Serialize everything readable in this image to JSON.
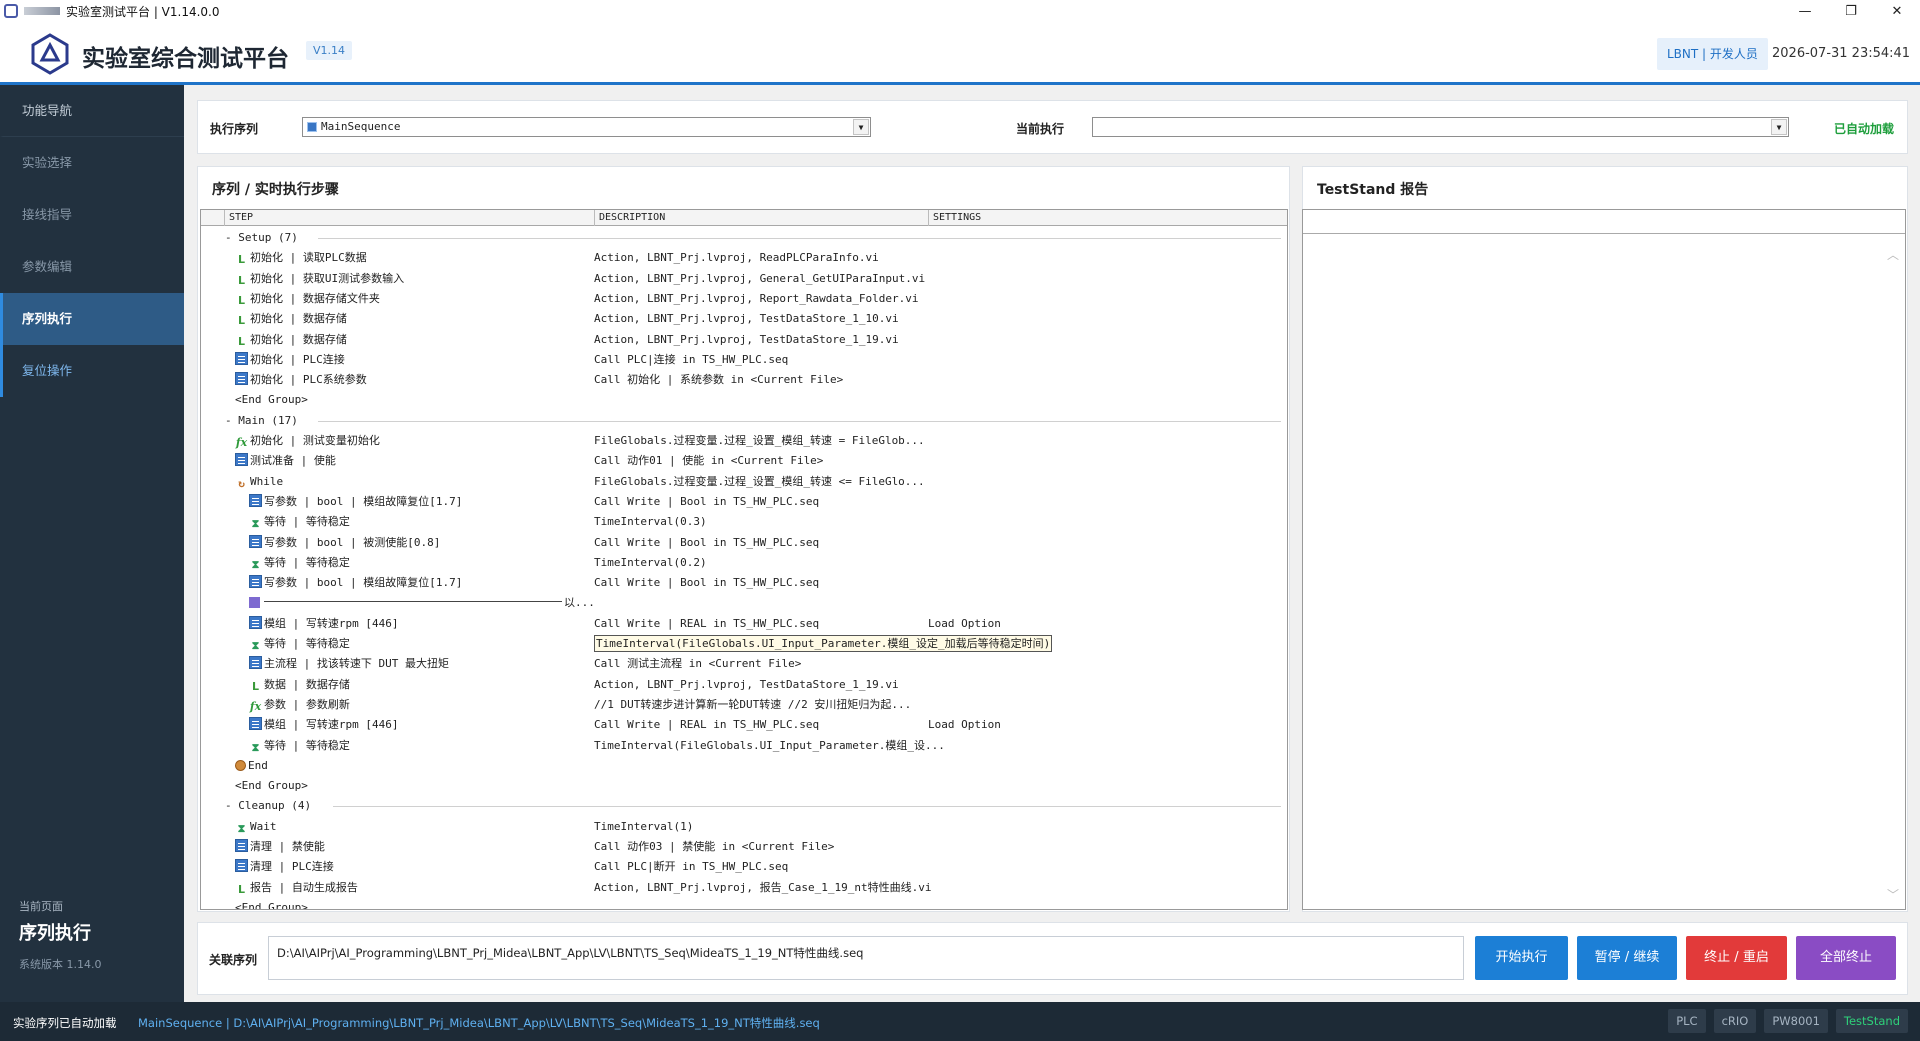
{
  "window": {
    "title": "实验室测试平台 | V1.14.0.0",
    "controls": [
      "—",
      "❐",
      "✕"
    ]
  },
  "header": {
    "app_title": "实验室综合测试平台",
    "version_badge": "V1.14",
    "user_badge": "LBNT | 开发人员",
    "datetime": "2026-07-31  23:54:41",
    "accent": "#1f74c9"
  },
  "sidebar": {
    "items": [
      {
        "label": "功能导航",
        "state": "head"
      },
      {
        "label": "实验选择",
        "state": "normal"
      },
      {
        "label": "接线指导",
        "state": "normal"
      },
      {
        "label": "参数编辑",
        "state": "normal"
      },
      {
        "label": "序列执行",
        "state": "active"
      },
      {
        "label": "复位操作",
        "state": "reset"
      }
    ],
    "current_page_label": "当前页面",
    "current_page": "序列执行",
    "system_version": "系统版本 1.14.0"
  },
  "toolbar": {
    "exec_seq_label": "执行序列",
    "exec_seq_value": "MainSequence",
    "current_exec_label": "当前执行",
    "current_exec_value": "",
    "auto_loaded": "已自动加载"
  },
  "steps_panel": {
    "title": "序列 / 实时执行步骤",
    "columns": [
      "STEP",
      "DESCRIPTION",
      "SETTINGS"
    ],
    "rows": [
      {
        "indent": 0,
        "icon": "group",
        "step": "- Setup (7)",
        "desc": "",
        "settings": "",
        "group": true
      },
      {
        "indent": 1,
        "icon": "L",
        "step": "初始化 | 读取PLC数据",
        "desc": "Action,  LBNT_Prj.lvproj, ReadPLCParaInfo.vi",
        "settings": ""
      },
      {
        "indent": 1,
        "icon": "L",
        "step": "初始化 | 获取UI测试参数输入",
        "desc": "Action,  LBNT_Prj.lvproj, General_GetUIParaInput.vi",
        "settings": ""
      },
      {
        "indent": 1,
        "icon": "L",
        "step": "初始化 | 数据存储文件夹",
        "desc": "Action,  LBNT_Prj.lvproj, Report_Rawdata_Folder.vi",
        "settings": ""
      },
      {
        "indent": 1,
        "icon": "L",
        "step": "初始化 | 数据存储",
        "desc": "Action,  LBNT_Prj.lvproj, TestDataStore_1_10.vi",
        "settings": ""
      },
      {
        "indent": 1,
        "icon": "L",
        "step": "初始化 | 数据存储",
        "desc": "Action,  LBNT_Prj.lvproj, TestDataStore_1_19.vi",
        "settings": ""
      },
      {
        "indent": 1,
        "icon": "call",
        "step": "初始化 | PLC连接",
        "desc": "Call PLC|连接 in TS_HW_PLC.seq",
        "settings": ""
      },
      {
        "indent": 1,
        "icon": "call",
        "step": "初始化 | PLC系统参数",
        "desc": "Call 初始化 | 系统参数 in <Current File>",
        "settings": ""
      },
      {
        "indent": 1,
        "icon": "none",
        "step": "<End Group>",
        "desc": "",
        "settings": ""
      },
      {
        "indent": 0,
        "icon": "group",
        "step": "- Main (17)",
        "desc": "",
        "settings": "",
        "group": true
      },
      {
        "indent": 1,
        "icon": "fx",
        "step": "初始化 | 测试变量初始化",
        "desc": "FileGlobals.过程变量.过程_设置_模组_转速 = FileGlob...",
        "settings": ""
      },
      {
        "indent": 1,
        "icon": "call",
        "step": "测试准备 | 使能",
        "desc": "Call 动作01 | 使能 in <Current File>",
        "settings": ""
      },
      {
        "indent": 1,
        "icon": "loop",
        "step": "While",
        "desc": "FileGlobals.过程变量.过程_设置_模组_转速 <= FileGlo...",
        "settings": ""
      },
      {
        "indent": 2,
        "icon": "call",
        "step": "写参数 | bool | 模组故障复位[1.7]",
        "desc": "Call Write | Bool in TS_HW_PLC.seq",
        "settings": ""
      },
      {
        "indent": 2,
        "icon": "hg",
        "step": "等待 | 等待稳定",
        "desc": "TimeInterval(0.3)",
        "settings": ""
      },
      {
        "indent": 2,
        "icon": "call",
        "step": "写参数 | bool | 被测使能[0.8]",
        "desc": "Call Write | Bool in TS_HW_PLC.seq",
        "settings": ""
      },
      {
        "indent": 2,
        "icon": "hg",
        "step": "等待 | 等待稳定",
        "desc": "TimeInterval(0.2)",
        "settings": ""
      },
      {
        "indent": 2,
        "icon": "call",
        "step": "写参数 | bool | 模组故障复位[1.7]",
        "desc": "Call Write | Bool in TS_HW_PLC.seq",
        "settings": ""
      },
      {
        "indent": 2,
        "icon": "label",
        "step": "以...",
        "desc": "",
        "settings": "",
        "separator": true
      },
      {
        "indent": 2,
        "icon": "call",
        "step": "模组 | 写转速rpm [446]",
        "desc": "Call Write | REAL in TS_HW_PLC.seq",
        "settings": "Load Option"
      },
      {
        "indent": 2,
        "icon": "hg",
        "step": "等待 | 等待稳定",
        "desc": "TimeInterval(FileGlobals.UI_Input_Parameter.模组_设定_加载后等待稳定时间)",
        "settings": "",
        "highlight": true
      },
      {
        "indent": 2,
        "icon": "call",
        "step": "主流程 | 找该转速下 DUT 最大扭矩",
        "desc": "Call 测试主流程 in <Current File>",
        "settings": ""
      },
      {
        "indent": 2,
        "icon": "L",
        "step": "数据 | 数据存储",
        "desc": "Action,  LBNT_Prj.lvproj, TestDataStore_1_19.vi",
        "settings": ""
      },
      {
        "indent": 2,
        "icon": "fx",
        "step": "参数 | 参数刷新",
        "desc": "//1 DUT转速步进计算新一轮DUT转速 //2 安川扭矩归为起...",
        "settings": ""
      },
      {
        "indent": 2,
        "icon": "call",
        "step": "模组 | 写转速rpm [446]",
        "desc": "Call Write | REAL in TS_HW_PLC.seq",
        "settings": "Load Option"
      },
      {
        "indent": 2,
        "icon": "hg",
        "step": "等待 | 等待稳定",
        "desc": "TimeInterval(FileGlobals.UI_Input_Parameter.模组_设...",
        "settings": ""
      },
      {
        "indent": 1,
        "icon": "end",
        "step": "End",
        "desc": "",
        "settings": ""
      },
      {
        "indent": 1,
        "icon": "none",
        "step": "<End Group>",
        "desc": "",
        "settings": ""
      },
      {
        "indent": 0,
        "icon": "group",
        "step": "- Cleanup (4)",
        "desc": "",
        "settings": "",
        "group": true
      },
      {
        "indent": 1,
        "icon": "hg",
        "step": "Wait",
        "desc": "TimeInterval(1)",
        "settings": ""
      },
      {
        "indent": 1,
        "icon": "call",
        "step": "清理 | 禁使能",
        "desc": "Call 动作03 | 禁使能 in <Current File>",
        "settings": ""
      },
      {
        "indent": 1,
        "icon": "call",
        "step": "清理 | PLC连接",
        "desc": "Call PLC|断开 in TS_HW_PLC.seq",
        "settings": ""
      },
      {
        "indent": 1,
        "icon": "L",
        "step": "报告 | 自动生成报告",
        "desc": "Action,  LBNT_Prj.lvproj, 报告_Case_1_19_nt特性曲线.vi",
        "settings": ""
      },
      {
        "indent": 1,
        "icon": "none",
        "step": "<End Group>",
        "desc": "",
        "settings": ""
      }
    ]
  },
  "report_panel": {
    "title": "TestStand 报告"
  },
  "bottom": {
    "linked_seq_label": "关联序列",
    "linked_seq_path": "D:\\AI\\AIPrj\\AI_Programming\\LBNT_Prj_Midea\\LBNT_App\\LV\\LBNT\\TS_Seq\\MideaTS_1_19_NT特性曲线.seq",
    "btn_start": "开始执行",
    "btn_pause": "暂停 / 继续",
    "btn_stop": "终止 / 重启",
    "btn_all": "全部终止"
  },
  "statusbar": {
    "text": "实验序列已自动加载",
    "seq": "MainSequence  |  D:\\AI\\AIPrj\\AI_Programming\\LBNT_Prj_Midea\\LBNT_App\\LV\\LBNT\\TS_Seq\\MideaTS_1_19_NT特性曲线.seq",
    "tags": [
      {
        "label": "PLC",
        "on": false
      },
      {
        "label": "cRIO",
        "on": false
      },
      {
        "label": "PW8001",
        "on": false
      },
      {
        "label": "TestStand",
        "on": true
      }
    ]
  }
}
